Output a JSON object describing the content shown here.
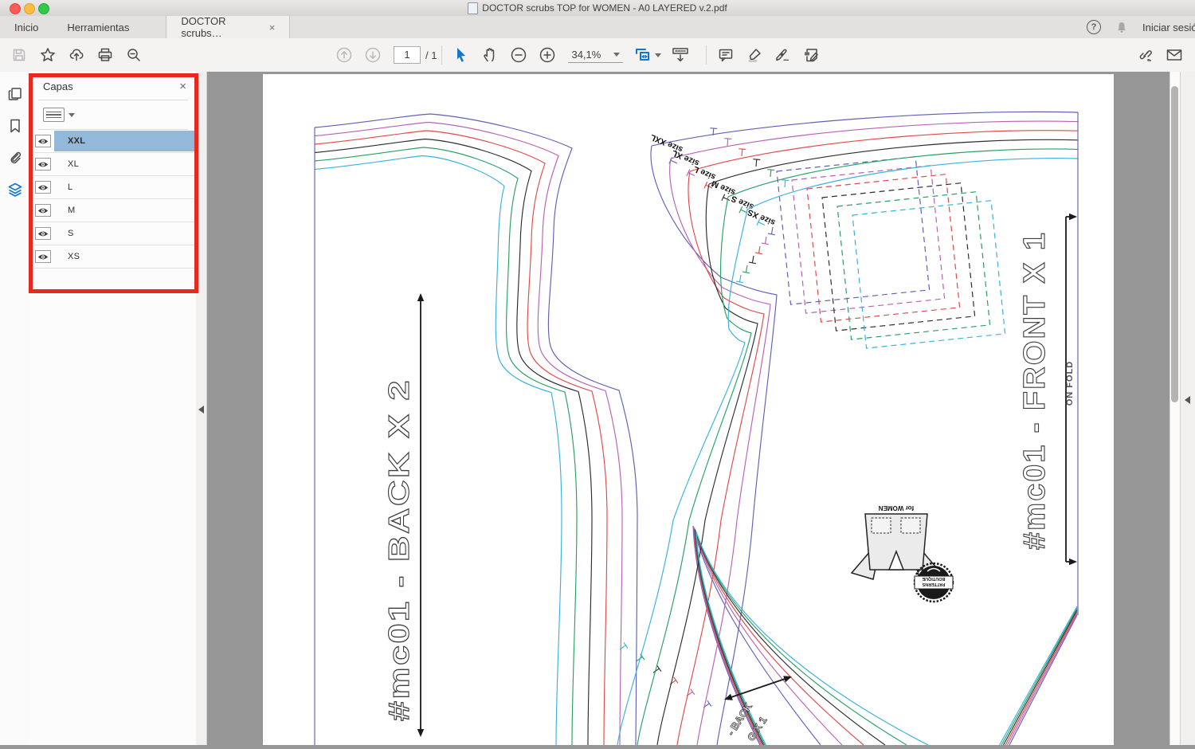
{
  "window": {
    "title": "DOCTOR scrubs TOP for WOMEN - A0 LAYERED v.2.pdf"
  },
  "tabbar": {
    "home_tab": "Inicio",
    "tools_tab": "Herramientas",
    "doc_tab": "DOCTOR scrubs…",
    "doc_tab_close": "×",
    "help": "?",
    "sign_in": "Iniciar sesión"
  },
  "toolbar": {
    "page_current": "1",
    "page_total": "/ 1",
    "zoom_value": "34,1%"
  },
  "layers_panel": {
    "title": "Capas",
    "close": "×",
    "layers": [
      {
        "label": "XXL",
        "selected": true
      },
      {
        "label": "XL",
        "selected": false
      },
      {
        "label": "L",
        "selected": false
      },
      {
        "label": "M",
        "selected": false
      },
      {
        "label": "S",
        "selected": false
      },
      {
        "label": "XS",
        "selected": false
      }
    ]
  },
  "pattern": {
    "back_piece_label": "#mc01 - BACK X 2",
    "front_piece_label": "#mc01 - FRONT X 1",
    "on_fold_label": "ON FOLD",
    "facing_label_top": "- BACK",
    "facing_label_bottom": "G X 1",
    "size_labels": [
      "size XXL",
      "size XL",
      "size L",
      "size M",
      "size S",
      "size XS"
    ],
    "logo_caption": "for WOMEN",
    "stamp_line1": "PATTERNS",
    "stamp_line2": "BOUTIQUE",
    "colors": {
      "XXL": "#6060b8",
      "XL": "#b962b4",
      "L": "#e04a4a",
      "M": "#2d2d2d",
      "S": "#27a162",
      "XS": "#38b2de"
    }
  }
}
